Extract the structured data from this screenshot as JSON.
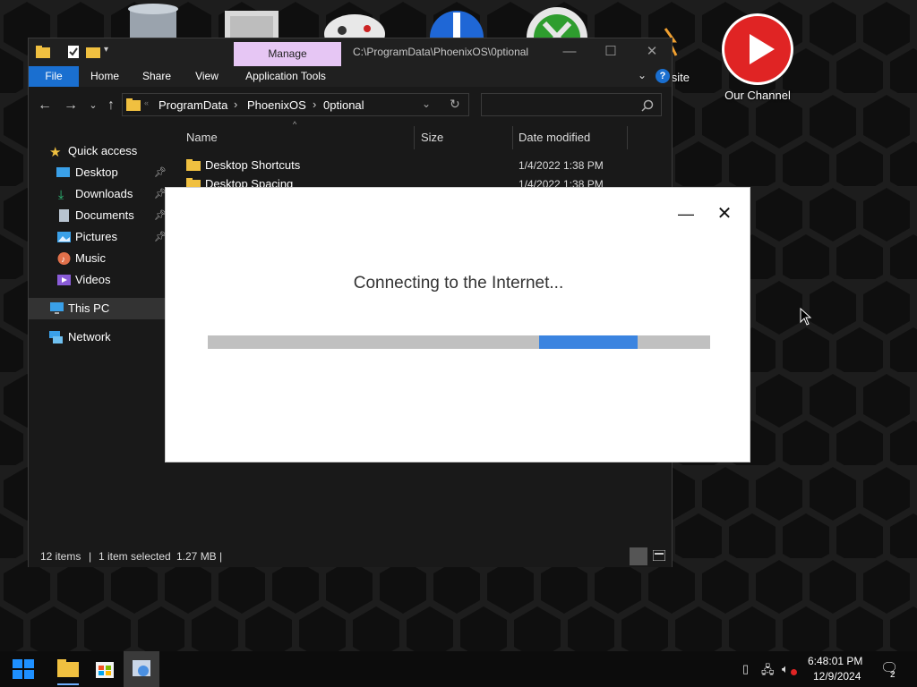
{
  "desktop": {
    "icons": [
      {
        "name": "recycle-bin",
        "label": ""
      },
      {
        "name": "folder",
        "label": ""
      },
      {
        "name": "game-controller",
        "label": ""
      },
      {
        "name": "app",
        "label": ""
      },
      {
        "name": "xbox",
        "label": ""
      },
      {
        "name": "website-partial",
        "label": "site"
      },
      {
        "name": "our-channel",
        "label": "Our Channel"
      }
    ]
  },
  "explorer": {
    "manage_tab": "Manage",
    "title_path": "C:\\ProgramData\\PhoenixOS\\0ptional",
    "ribbon_tabs": [
      "File",
      "Home",
      "Share",
      "View",
      "Application Tools"
    ],
    "breadcrumb": [
      "ProgramData",
      "PhoenixOS",
      "0ptional"
    ],
    "search_placeholder": "",
    "nav": {
      "quick_access": "Quick access",
      "items": [
        "Desktop",
        "Downloads",
        "Documents",
        "Pictures",
        "Music",
        "Videos"
      ],
      "this_pc": "This PC",
      "network": "Network"
    },
    "columns": {
      "name": "Name",
      "size": "Size",
      "date": "Date modified"
    },
    "files": [
      {
        "name": "Desktop Shortcuts",
        "date": "1/4/2022 1:38 PM"
      },
      {
        "name": "Desktop Spacing",
        "date": "1/4/2022 1:38 PM"
      }
    ],
    "status": {
      "count": "12 items",
      "selection": "1 item selected",
      "size": "1.27 MB"
    }
  },
  "dialog": {
    "message": "Connecting to the Internet...",
    "progress": {
      "segment_start": 0.66,
      "segment_end": 0.856
    }
  },
  "taskbar": {
    "time": "6:48:01 PM",
    "date": "12/9/2024",
    "notification_count": "2"
  },
  "colors": {
    "accent": "#1a6fd0",
    "manage_tab": "#e6c6f4",
    "progress": "#3b84e0",
    "folder": "#f0c040"
  }
}
